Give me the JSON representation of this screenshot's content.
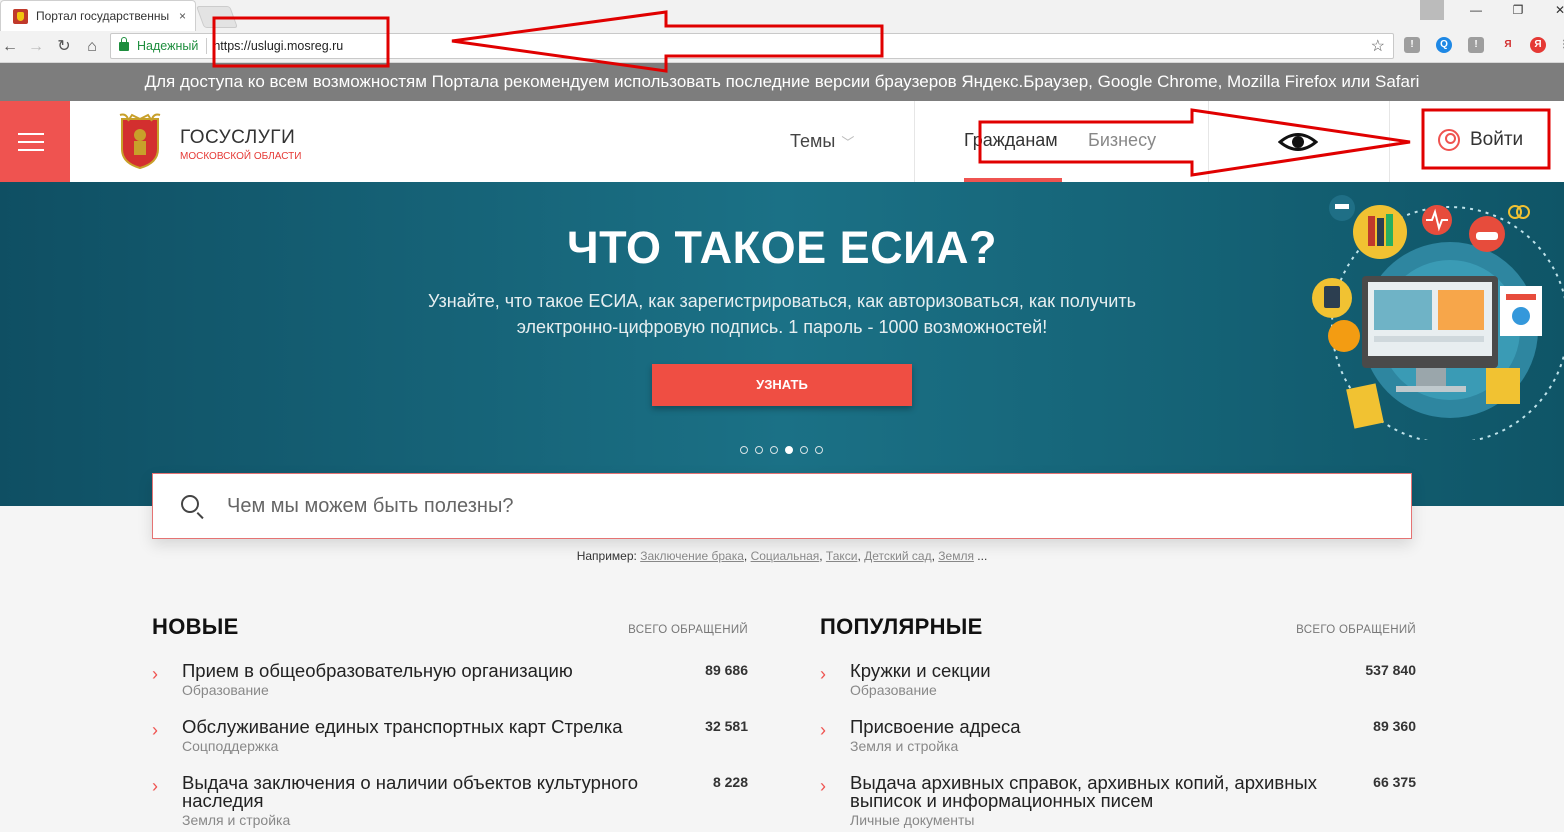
{
  "browser": {
    "tab_title": "Портал государственны",
    "tab_close": "×",
    "window_controls": {
      "minimize": "—",
      "maximize": "❐",
      "close": "✕"
    },
    "nav": {
      "back": "←",
      "forward": "→",
      "reload": "↻",
      "home": "⌂"
    },
    "secure_label": "Надежный",
    "url": "https://uslugi.mosreg.ru",
    "star": "☆",
    "extensions": [
      "!",
      "Q",
      "!",
      "Я",
      "Я",
      "⋮"
    ]
  },
  "notice": "Для доступа ко всем возможностям Портала рекомендуем использовать последние версии браузеров Яндекс.Браузер, Google Chrome, Mozilla Firefox или Safari",
  "header": {
    "brand_title": "ГОСУСЛУГИ",
    "brand_subtitle": "МОСКОВСКОЙ ОБЛАСТИ",
    "themes_label": "Темы",
    "themes_chevron": "﹀",
    "audience_active": "Гражданам",
    "audience_other": "Бизнесу",
    "login_label": "Войти"
  },
  "hero": {
    "title": "ЧТО ТАКОЕ ЕСИА?",
    "description": "Узнайте, что такое ЕСИА, как зарегистрироваться, как авторизоваться, как получить электронно-цифровую подпись. 1 пароль - 1000 возможностей!",
    "button_label": "УЗНАТЬ",
    "slides_count": 6,
    "active_slide": 4
  },
  "search": {
    "placeholder": "Чем мы можем быть полезны?",
    "examples_prefix": "Например:",
    "examples": [
      "Заключение брака",
      "Социальная",
      "Такси",
      "Детский сад",
      "Земля"
    ],
    "examples_suffix": "..."
  },
  "lists": {
    "total_label": "ВСЕГО ОБРАЩЕНИЙ",
    "arrow": "›",
    "new": {
      "title": "НОВЫЕ",
      "items": [
        {
          "name": "Прием в общеобразовательную организацию",
          "category": "Образование",
          "count": "89 686"
        },
        {
          "name": "Обслуживание единых транспортных карт Стрелка",
          "category": "Соцподдержка",
          "count": "32 581"
        },
        {
          "name": "Выдача заключения о наличии объектов культурного наследия",
          "category": "Земля и стройка",
          "count": "8 228"
        }
      ]
    },
    "popular": {
      "title": "ПОПУЛЯРНЫЕ",
      "items": [
        {
          "name": "Кружки и секции",
          "category": "Образование",
          "count": "537 840"
        },
        {
          "name": "Присвоение адреса",
          "category": "Земля и стройка",
          "count": "89 360"
        },
        {
          "name": "Выдача архивных справок, архивных копий, архивных выписок и информационных писем",
          "category": "Личные документы",
          "count": "66 375"
        }
      ]
    }
  },
  "colors": {
    "accent": "#ef5350",
    "hero_bg": "#1b7186",
    "annotation": "#e00000"
  }
}
